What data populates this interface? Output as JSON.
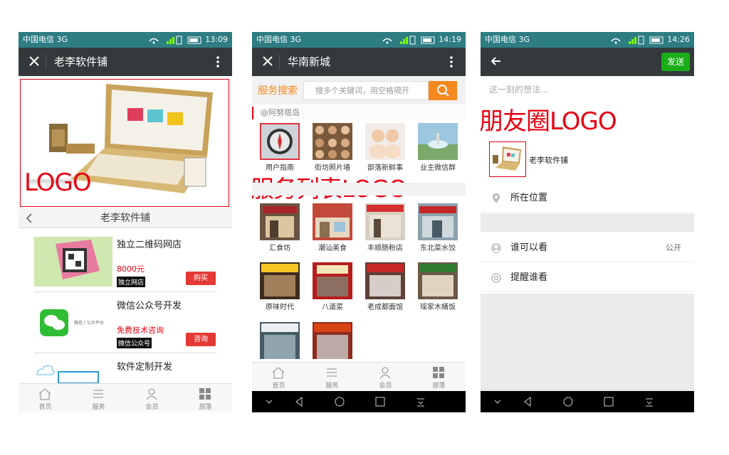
{
  "status_bars": [
    {
      "carrier": "中国电信 3G",
      "time": "13:09"
    },
    {
      "carrier": "中国电信 3G",
      "time": "14:19"
    },
    {
      "carrier": "中国电信 3G",
      "time": "14:26"
    }
  ],
  "phone1": {
    "nav_title": "老李软件铺",
    "annotation": "LOGO",
    "shop_title": "老李软件铺",
    "products": [
      {
        "name": "独立二维码网店",
        "price": "8000元",
        "tag": "独立网店",
        "button": "购买"
      },
      {
        "name": "微信公众号开发",
        "price": "免费技术咨询",
        "tag": "微信公众号",
        "button": "咨询",
        "thumb_text": "微信 | 公众平台"
      },
      {
        "name": "软件定制开发",
        "price": "",
        "tag": "",
        "button": ""
      }
    ],
    "tabs": [
      "首页",
      "服务",
      "会员",
      "部落"
    ]
  },
  "phone2": {
    "nav_title": "华南新城",
    "search_label": "服务搜索",
    "search_placeholder": "搜多个关键词，用空格隔开",
    "category": "@阿努塔岛",
    "annotation": "服务列表LOGO",
    "row1": [
      "用户指南",
      "街坊照片墙",
      "部落新鲜事",
      "业主微信群"
    ],
    "row2": [
      "汇食坊",
      "潮汕美食",
      "丰顺肠粉店",
      "东北菜水饺"
    ],
    "row3": [
      "原味时代",
      "八道菜",
      "老成都面馆",
      "瑶家木桶饭"
    ],
    "tabs": [
      "首页",
      "服务",
      "会员",
      "部落"
    ]
  },
  "phone3": {
    "send_label": "发送",
    "thought_placeholder": "这一刻的想法...",
    "annotation": "朋友圈LOGO",
    "link_title": "老李软件铺",
    "location": "所在位置",
    "who_can_see": "谁可以看",
    "visibility": "公开",
    "remind": "提醒谁看"
  },
  "colors": {
    "status": "#2d7d83",
    "navbar": "#343a3c",
    "accent": "#f5891f",
    "red": "#e60012",
    "green": "#1aad19"
  }
}
